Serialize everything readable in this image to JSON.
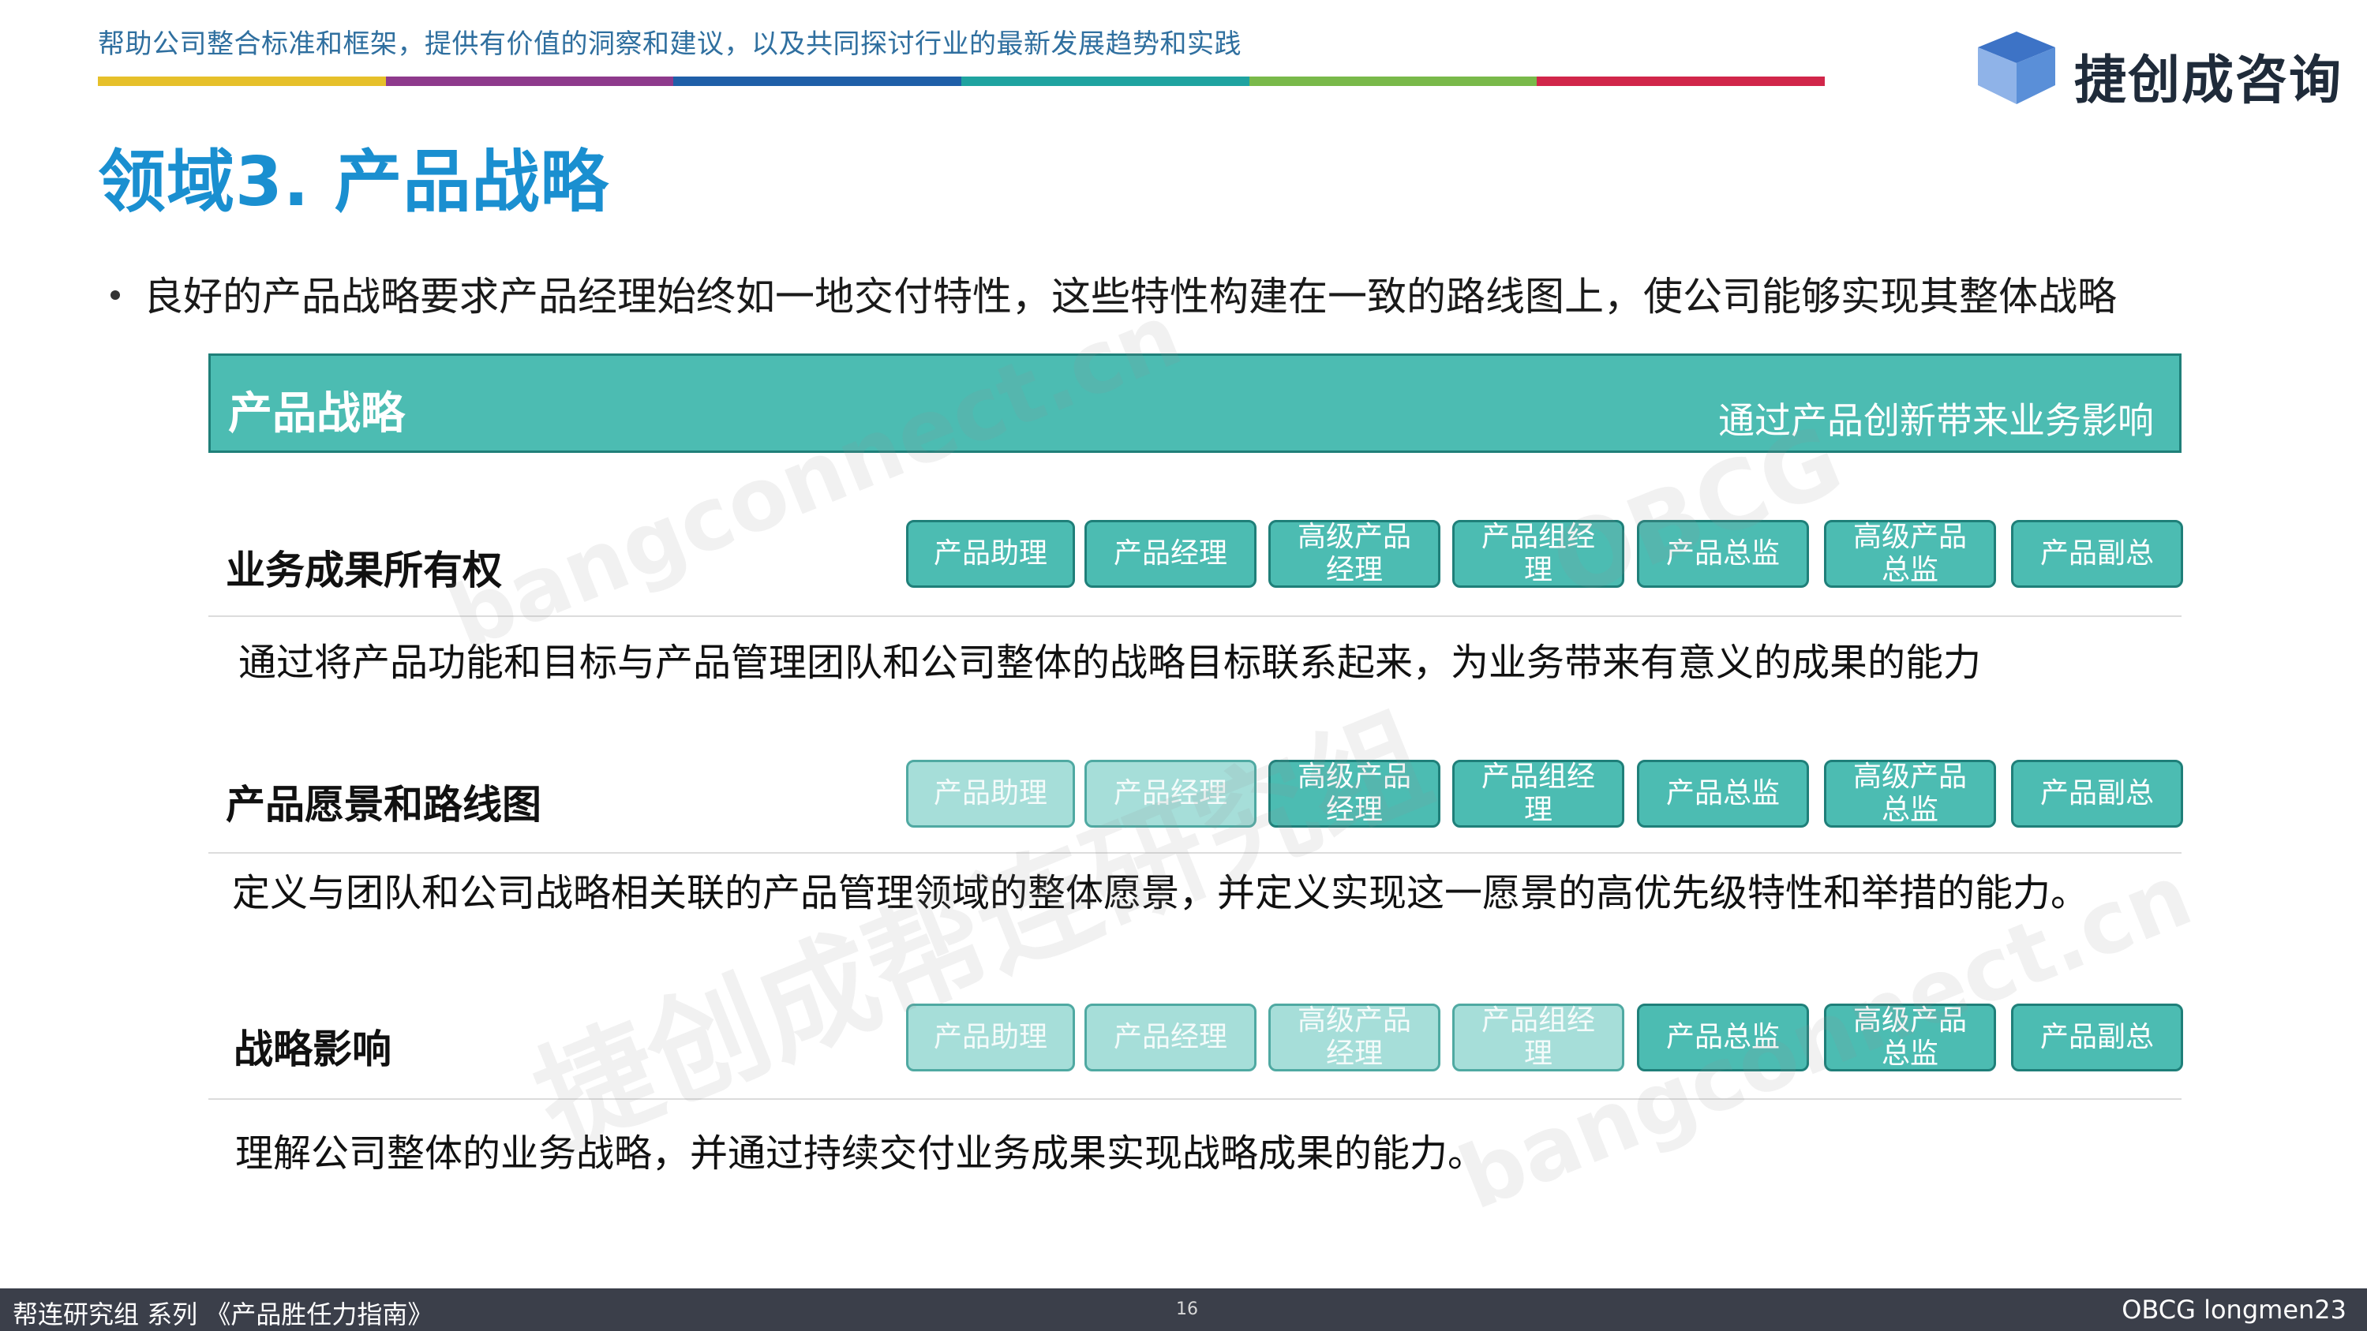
{
  "header": {
    "tagline": "帮助公司整合标准和框架，提供有价值的洞察和建议，以及共同探讨行业的最新发展趋势和实践",
    "color_bar": [
      "#e6c02a",
      "#8e3a8c",
      "#1f5fa8",
      "#1fa3a0",
      "#79b94a",
      "#d1264a"
    ]
  },
  "logo": {
    "text": "捷创成咨询",
    "icon": "cube-logo-icon",
    "colors": [
      "#3d73c6",
      "#8fb3e8",
      "#5a8fd8"
    ]
  },
  "title": "领域3. 产品战略",
  "intro": "良好的产品战略要求产品经理始终如一地交付特性，这些特性构建在一致的路线图上，使公司能够实现其整体战略",
  "band": {
    "title": "产品战略",
    "subtitle": "通过产品创新带来业务影响"
  },
  "sections": [
    {
      "title": "业务成果所有权",
      "description": "通过将产品功能和目标与产品管理团队和公司整体的战略目标联系起来，为业务带来有意义的成果的能力",
      "levels": [
        {
          "label": "产品助理",
          "active": true
        },
        {
          "label": "产品经理",
          "active": true
        },
        {
          "label": "高级产品经理",
          "active": true
        },
        {
          "label": "产品组经理",
          "active": true
        },
        {
          "label": "产品总监",
          "active": true
        },
        {
          "label": "高级产品总监",
          "active": true
        },
        {
          "label": "产品副总",
          "active": true
        }
      ]
    },
    {
      "title": "产品愿景和路线图",
      "description": "定义与团队和公司战略相关联的产品管理领域的整体愿景，并定义实现这一愿景的高优先级特性和举措的能力。",
      "levels": [
        {
          "label": "产品助理",
          "active": false
        },
        {
          "label": "产品经理",
          "active": false
        },
        {
          "label": "高级产品经理",
          "active": true
        },
        {
          "label": "产品组经理",
          "active": true
        },
        {
          "label": "产品总监",
          "active": true
        },
        {
          "label": "高级产品总监",
          "active": true
        },
        {
          "label": "产品副总",
          "active": true
        }
      ]
    },
    {
      "title": "战略影响",
      "description": "理解公司整体的业务战略，并通过持续交付业务成果实现战略成果的能力。",
      "levels": [
        {
          "label": "产品助理",
          "active": false
        },
        {
          "label": "产品经理",
          "active": false
        },
        {
          "label": "高级产品经理",
          "active": false
        },
        {
          "label": "产品组经理",
          "active": false
        },
        {
          "label": "产品总监",
          "active": true
        },
        {
          "label": "高级产品总监",
          "active": true
        },
        {
          "label": "产品副总",
          "active": true
        }
      ]
    }
  ],
  "footer": {
    "left": "帮连研究组 系列 《产品胜任力指南》",
    "page": "16",
    "right": "OBCG longmen23"
  },
  "watermarks": [
    "bangconnect.cn",
    "OBCG",
    "捷创成帮连研究组",
    "bangconnect.cn"
  ]
}
